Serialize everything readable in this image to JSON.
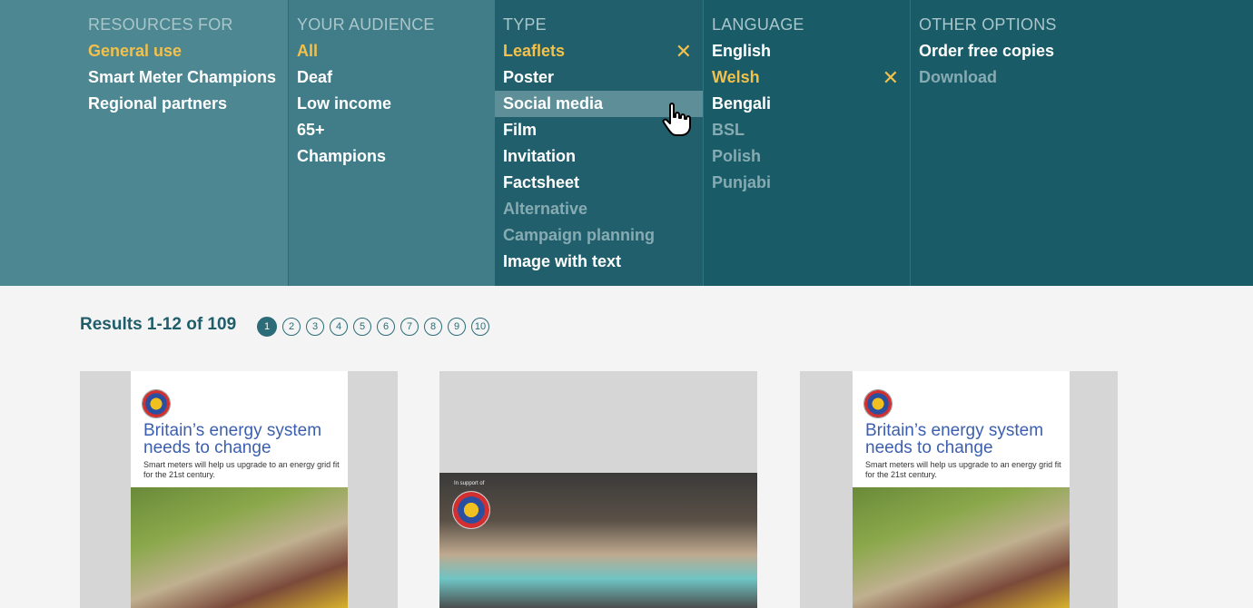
{
  "filters": {
    "resources_for": {
      "heading": "RESOURCES FOR",
      "items": [
        "General use",
        "Smart Meter Champions",
        "Regional partners"
      ]
    },
    "audience": {
      "heading": "YOUR AUDIENCE",
      "items": [
        "All",
        "Deaf",
        "Low income",
        "65+",
        "Champions"
      ]
    },
    "type": {
      "heading": "TYPE",
      "items": [
        "Leaflets",
        "Poster",
        "Social media",
        "Film",
        "Invitation",
        "Factsheet",
        "Alternative",
        "Campaign planning",
        "Image with text"
      ]
    },
    "language": {
      "heading": "LANGUAGE",
      "items": [
        "English",
        "Welsh",
        "Bengali",
        "BSL",
        "Polish",
        "Punjabi"
      ]
    },
    "other": {
      "heading": "OTHER OPTIONS",
      "items": [
        "Order free copies",
        "Download"
      ]
    },
    "remove_icon": "✕"
  },
  "results": {
    "label": "Results 1-12 of 109",
    "pages": [
      "1",
      "2",
      "3",
      "4",
      "5",
      "6",
      "7",
      "8",
      "9",
      "10"
    ],
    "current_page": "1"
  },
  "cards": [
    {
      "title": "Britain’s energy system needs to change",
      "subtitle": "Smart meters will help us upgrade to an energy grid fit for the 21st century."
    },
    {
      "tag": "In support of"
    },
    {
      "title": "Britain’s energy system needs to change",
      "subtitle": "Smart meters will help us upgrade to an energy grid fit for the 21st century."
    }
  ],
  "colors": {
    "accent": "#f2c14b",
    "teal_dark": "#1a5b68",
    "teal_mid": "#417d88",
    "teal_light": "#4d8791"
  },
  "icons": {
    "cursor": "hand-pointer-icon"
  }
}
